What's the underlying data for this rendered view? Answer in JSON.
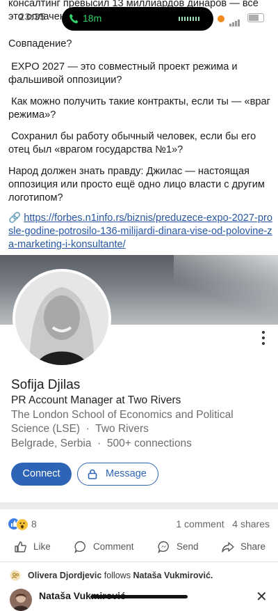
{
  "status_bar": {
    "time": "23:35",
    "call_duration": "18m"
  },
  "post": {
    "top_cut_line": "консалтинг превысил 13 миллиардов динаров — всё",
    "top_cut_line2": "это оплачено",
    "paragraphs": [
      "Совпадение?",
      " EXPO 2027 — это совместный проект режима и фальшивой оппозиции?",
      " Как можно получить такие контракты, если ты — «враг режима»?",
      " Сохранил бы работу обычный человек, если бы его отец был «врагом государства №1»?",
      "Народ должен знать правду: Джилас — настоящая оппозиция или просто ещё одно лицо власти с другим логотипом?"
    ],
    "link_icon": "🔗",
    "link": "https://forbes.n1info.rs/biznis/preduzece-expo-2027-prosle-godine-potrosilo-136-milijardi-dinara-vise-od-polovine-za-marketing-i-konsultante/"
  },
  "profile_card": {
    "name": "Sofija Djilas",
    "headline": "PR Account Manager at Two Rivers",
    "education": "The London School of Economics and Political Science (LSE)",
    "company": "Two Rivers",
    "location": "Belgrade, Serbia",
    "connections": "500+ connections",
    "dot": "·",
    "connect_label": "Connect",
    "message_label": "Message"
  },
  "engagement": {
    "reaction_count": "8",
    "comments": "1 comment",
    "shares": "4 shares",
    "actions": {
      "like": "Like",
      "comment": "Comment",
      "send": "Send",
      "share": "Share"
    }
  },
  "activity": {
    "actor": "Olivera Djordjevic",
    "verb": "follows",
    "target": "Nataša Vukmirović."
  },
  "next_post": {
    "author": "Nataša Vukmirović"
  },
  "colors": {
    "accent": "#2e64b5",
    "link": "#2757a0",
    "call_green": "#33d16a"
  }
}
